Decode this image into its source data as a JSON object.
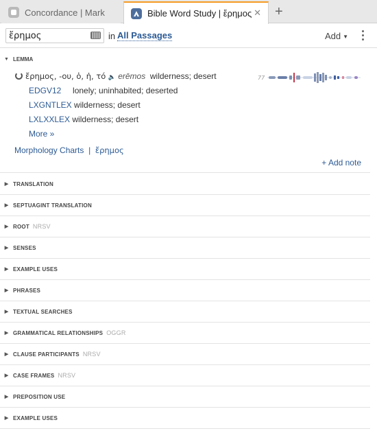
{
  "tabs": [
    {
      "label": "Concordance | Mark"
    },
    {
      "label": "Bible Word Study | ἔρημος",
      "close": "✕"
    }
  ],
  "new_tab": "+",
  "search": {
    "value": "ἔρημος"
  },
  "scope": {
    "in": "in",
    "value": "All Passages"
  },
  "toolbar": {
    "add": "Add"
  },
  "lemma": {
    "section": "LEMMA",
    "headword": "ἔρημος, -ου, ὁ, ἡ, τό",
    "speaker": "🔈",
    "translit": "erēmos",
    "gloss": "wilderness; desert",
    "spark_label": "77",
    "lexicons": [
      {
        "name": "EDGV12",
        "def": "lonely; uninhabited; deserted"
      },
      {
        "name": "LXGNTLEX",
        "def": "wilderness; desert"
      },
      {
        "name": "LXLXXLEX",
        "def": "wilderness; desert"
      }
    ],
    "more": "More »",
    "morph": "Morphology Charts",
    "sep": "|",
    "morph_word": "ἔρημος",
    "add_note": "+ Add note"
  },
  "sections": [
    {
      "label": "TRANSLATION",
      "extra": ""
    },
    {
      "label": "SEPTUAGINT TRANSLATION",
      "extra": ""
    },
    {
      "label": "ROOT",
      "extra": "NRSV"
    },
    {
      "label": "SENSES",
      "extra": ""
    },
    {
      "label": "EXAMPLE USES",
      "extra": ""
    },
    {
      "label": "PHRASES",
      "extra": ""
    },
    {
      "label": "TEXTUAL SEARCHES",
      "extra": ""
    },
    {
      "label": "GRAMMATICAL RELATIONSHIPS",
      "extra": "OGGR"
    },
    {
      "label": "CLAUSE PARTICIPANTS",
      "extra": "NRSV"
    },
    {
      "label": "CASE FRAMES",
      "extra": "NRSV"
    },
    {
      "label": "PREPOSITION USE",
      "extra": ""
    },
    {
      "label": "EXAMPLE USES",
      "extra": ""
    }
  ]
}
